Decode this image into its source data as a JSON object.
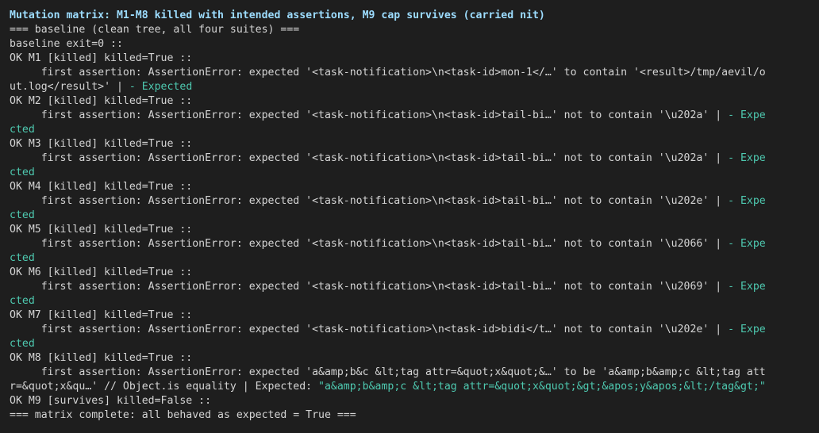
{
  "title": "Mutation matrix: M1-M8 killed with intended assertions, M9 cap survives (carried nit)",
  "colors": {
    "background": "#1e1e1e",
    "text": "#d4d4d4",
    "title": "#9cdcfe",
    "expected": "#4ec9b0"
  },
  "lines": [
    {
      "t": "=== baseline (clean tree, all four suites) ==="
    },
    {
      "t": "baseline exit=0 ::"
    },
    {
      "t": "OK M1 [killed] killed=True ::"
    },
    {
      "t": "     first assertion: AssertionError: expected '<task-notification>\\n<task-id>mon-1</…' to contain '<result>/tmp/aevil/o"
    },
    {
      "t": "ut.log</result>' | ",
      "g": "- Expected"
    },
    {
      "t": "OK M2 [killed] killed=True ::"
    },
    {
      "t": "     first assertion: AssertionError: expected '<task-notification>\\n<task-id>tail-bi…' not to contain '\\u202a' | ",
      "g": "- Expe"
    },
    {
      "t": "",
      "g": "cted"
    },
    {
      "t": "OK M3 [killed] killed=True ::"
    },
    {
      "t": "     first assertion: AssertionError: expected '<task-notification>\\n<task-id>tail-bi…' not to contain '\\u202a' | ",
      "g": "- Expe"
    },
    {
      "t": "",
      "g": "cted"
    },
    {
      "t": "OK M4 [killed] killed=True ::"
    },
    {
      "t": "     first assertion: AssertionError: expected '<task-notification>\\n<task-id>tail-bi…' not to contain '\\u202e' | ",
      "g": "- Expe"
    },
    {
      "t": "",
      "g": "cted"
    },
    {
      "t": "OK M5 [killed] killed=True ::"
    },
    {
      "t": "     first assertion: AssertionError: expected '<task-notification>\\n<task-id>tail-bi…' not to contain '\\u2066' | ",
      "g": "- Expe"
    },
    {
      "t": "",
      "g": "cted"
    },
    {
      "t": "OK M6 [killed] killed=True ::"
    },
    {
      "t": "     first assertion: AssertionError: expected '<task-notification>\\n<task-id>tail-bi…' not to contain '\\u2069' | ",
      "g": "- Expe"
    },
    {
      "t": "",
      "g": "cted"
    },
    {
      "t": "OK M7 [killed] killed=True ::"
    },
    {
      "t": "     first assertion: AssertionError: expected '<task-notification>\\n<task-id>bidi</t…' not to contain '\\u202e' | ",
      "g": "- Expe"
    },
    {
      "t": "",
      "g": "cted"
    },
    {
      "t": "OK M8 [killed] killed=True ::"
    },
    {
      "t": "     first assertion: AssertionError: expected 'a&amp;b&c &lt;tag attr=&quot;x&quot;&…' to be 'a&amp;b&amp;c &lt;tag att"
    },
    {
      "t": "r=&quot;x&qu…' // Object.is equality | Expected: ",
      "g": "\"a&amp;b&amp;c &lt;tag attr=&quot;x&quot;&gt;&apos;y&apos;&lt;/tag&gt;\""
    },
    {
      "t": "OK M9 [survives] killed=False ::"
    },
    {
      "t": "=== matrix complete: all behaved as expected = True ==="
    }
  ]
}
